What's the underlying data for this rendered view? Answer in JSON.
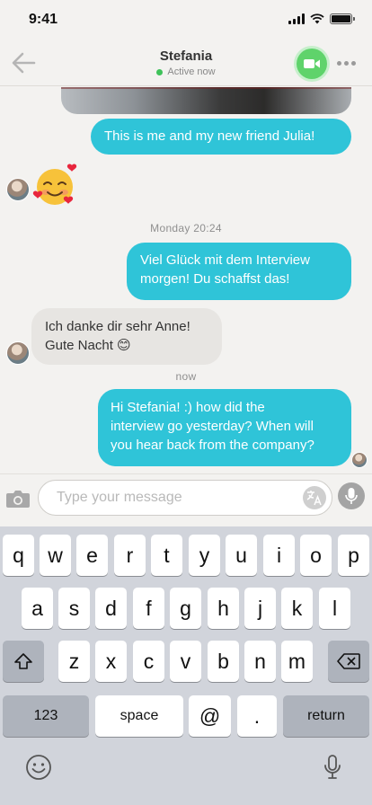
{
  "status_bar": {
    "time": "9:41"
  },
  "header": {
    "contact_name": "Stefania",
    "contact_status": "Active now"
  },
  "messages": [
    {
      "id": "m1",
      "direction": "out",
      "text": "This is me and my new friend Julia!"
    },
    {
      "id": "m2",
      "direction": "in",
      "type": "emoji",
      "emoji": "smiling-face-with-hearts"
    },
    {
      "id": "m3",
      "direction": "out",
      "text_lines": [
        "Viel Glück mit dem Interview",
        "morgen! Du schaffst das!"
      ]
    },
    {
      "id": "m4",
      "direction": "in",
      "text_lines": [
        "Ich danke dir sehr Anne!",
        "Gute Nacht 😊"
      ]
    },
    {
      "id": "m5",
      "direction": "out",
      "text_lines": [
        "Hi Stefania! :) how did the",
        "interview go yesterday? When will",
        "you hear back from the company?"
      ]
    }
  ],
  "timestamps": {
    "t1": "Monday 20:24",
    "t2": "now"
  },
  "composer": {
    "placeholder": "Type your message"
  },
  "keyboard": {
    "row1": [
      "q",
      "w",
      "e",
      "r",
      "t",
      "y",
      "u",
      "i",
      "o",
      "p"
    ],
    "row2": [
      "a",
      "s",
      "d",
      "f",
      "g",
      "h",
      "j",
      "k",
      "l"
    ],
    "row3": [
      "z",
      "x",
      "c",
      "v",
      "b",
      "n",
      "m"
    ],
    "numbers_label": "123",
    "space_label": "space",
    "at_label": "@",
    "period_label": ".",
    "return_label": "return"
  },
  "colors": {
    "outgoing_bubble": "#2fc4d8",
    "incoming_bubble": "#e7e5e2",
    "online": "#3fc25a",
    "video_button": "#5fd36b"
  },
  "icons": [
    "back-arrow-icon",
    "video-camera-icon",
    "more-icon",
    "camera-icon",
    "translate-icon",
    "microphone-icon",
    "shift-icon",
    "backspace-icon",
    "emoji-icon",
    "dictation-icon"
  ]
}
